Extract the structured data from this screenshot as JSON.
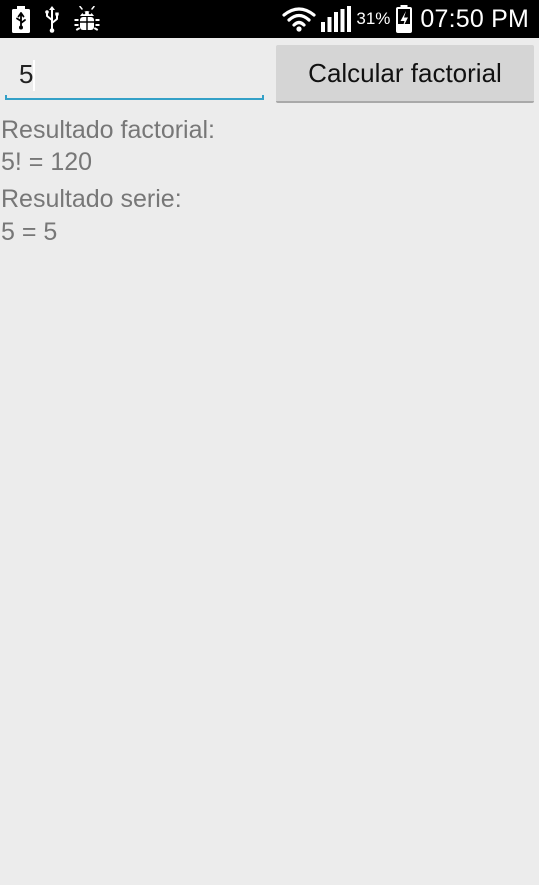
{
  "status_bar": {
    "left_icons": [
      "battery-saver-icon",
      "usb-icon",
      "android-debug-icon"
    ],
    "right_icons": [
      "wifi-icon",
      "signal-icon",
      "battery-charging-icon"
    ],
    "battery_percent": "31%",
    "time": "07:50 PM"
  },
  "form": {
    "number_value": "5",
    "calculate_button_label": "Calcular factorial",
    "accent_color": "#33a0c7"
  },
  "results": {
    "factorial_label": "Resultado factorial:",
    "factorial_value": "5! = 120",
    "series_label": "Resultado serie:",
    "series_value": "5 = 5"
  }
}
